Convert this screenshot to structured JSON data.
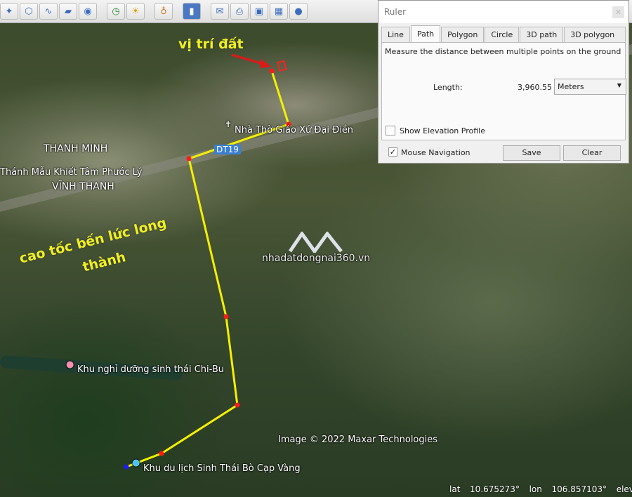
{
  "toolbar": {
    "icons": [
      "add-placemark-icon",
      "add-polygon-icon",
      "add-path-icon",
      "add-overlay-icon",
      "record-tour-icon",
      "historical-imagery-icon",
      "sunlight-icon",
      "planets-icon",
      "ruler-icon",
      "email-icon",
      "print-icon",
      "save-image-icon",
      "view-in-maps-icon",
      "earth-icon"
    ]
  },
  "map": {
    "annotation_label": "vị trí đất",
    "expressway_label_line1": "cao tốc bến lức long",
    "expressway_label_line2": "thành",
    "place_thanh_minh": "THANH MINH",
    "place_vinh_thanh": "VĨNH THANH",
    "place_church": "Nhà Thờ Giáo Xứ Đại Điền",
    "place_shrine": "Thánh Mẫu Khiết Tâm Phước Lý",
    "road_badge": "DT19",
    "place_resort": "Khu nghỉ dưỡng sinh thái Chi-Bu",
    "place_tourism": "Khu du lịch Sinh Thái Bò Cạp Vàng",
    "watermark": "nhadatdongnai360.vn",
    "copyright": "Image © 2022 Maxar Technologies",
    "path_color": "#f5f000",
    "vertex_color": "#ff1a1a",
    "start_color": "#1a1aff"
  },
  "ruler": {
    "title": "Ruler",
    "tabs": [
      "Line",
      "Path",
      "Polygon",
      "Circle",
      "3D path",
      "3D polygon"
    ],
    "selected_tab": "Path",
    "description": "Measure the distance between multiple points on the ground",
    "length_label": "Length:",
    "length_value": "3,960.55",
    "unit": "Meters",
    "show_elevation_label": "Show Elevation Profile",
    "show_elevation_checked": false,
    "mouse_nav_label": "Mouse Navigation",
    "mouse_nav_checked": true,
    "save_label": "Save",
    "clear_label": "Clear"
  },
  "status": {
    "lat_label": "lat",
    "lat": "10.675273°",
    "lon_label": "lon",
    "lon": "106.857103°",
    "elev_label": "elev"
  }
}
